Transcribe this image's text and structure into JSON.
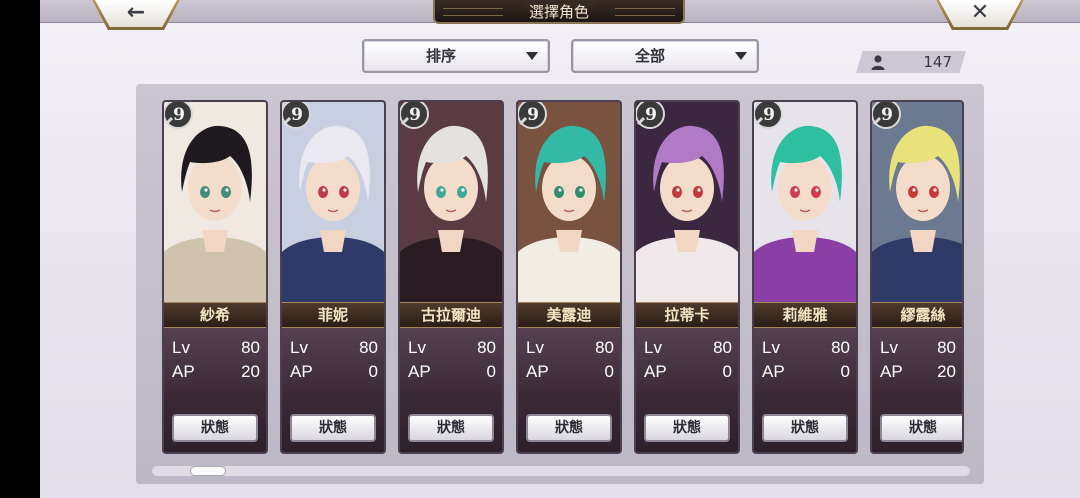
{
  "header": {
    "title": "選擇角色",
    "back_icon": "←",
    "close_icon": "✕"
  },
  "controls": {
    "sort_label": "排序",
    "filter_label": "全部",
    "character_count": "147"
  },
  "status_label": "狀態",
  "stat_labels": {
    "level": "Lv",
    "ap": "AP"
  },
  "badge_text": "9",
  "characters": [
    {
      "name": "紗希",
      "lv": "80",
      "ap": "20",
      "hair": "#1e1a20",
      "outfit": "#cfc3ad",
      "bg": "#efe9e2",
      "eyes": "#3f8c7a"
    },
    {
      "name": "菲妮",
      "lv": "80",
      "ap": "0",
      "hair": "#e9e9ef",
      "outfit": "#2d3a6a",
      "bg": "#c8cfe0",
      "eyes": "#c0384a"
    },
    {
      "name": "古拉爾迪",
      "lv": "80",
      "ap": "0",
      "hair": "#e4e2e0",
      "outfit": "#2a1c22",
      "bg": "#5a3b41",
      "eyes": "#3fa89a"
    },
    {
      "name": "美露迪",
      "lv": "80",
      "ap": "0",
      "hair": "#33b9a6",
      "outfit": "#f1ede3",
      "bg": "#7a5240",
      "eyes": "#2c8f6a"
    },
    {
      "name": "拉蒂卡",
      "lv": "80",
      "ap": "0",
      "hair": "#b07ac6",
      "outfit": "#f0e8ea",
      "bg": "#3b2840",
      "eyes": "#c03a3a"
    },
    {
      "name": "莉維雅",
      "lv": "80",
      "ap": "0",
      "hair": "#2ebfa0",
      "outfit": "#8a3fa6",
      "bg": "#e6e3ea",
      "eyes": "#d23a52"
    },
    {
      "name": "繆露絲",
      "lv": "80",
      "ap": "20",
      "hair": "#e9e27a",
      "outfit": "#2e3a66",
      "bg": "#6b7a90",
      "eyes": "#c83a3a"
    }
  ]
}
